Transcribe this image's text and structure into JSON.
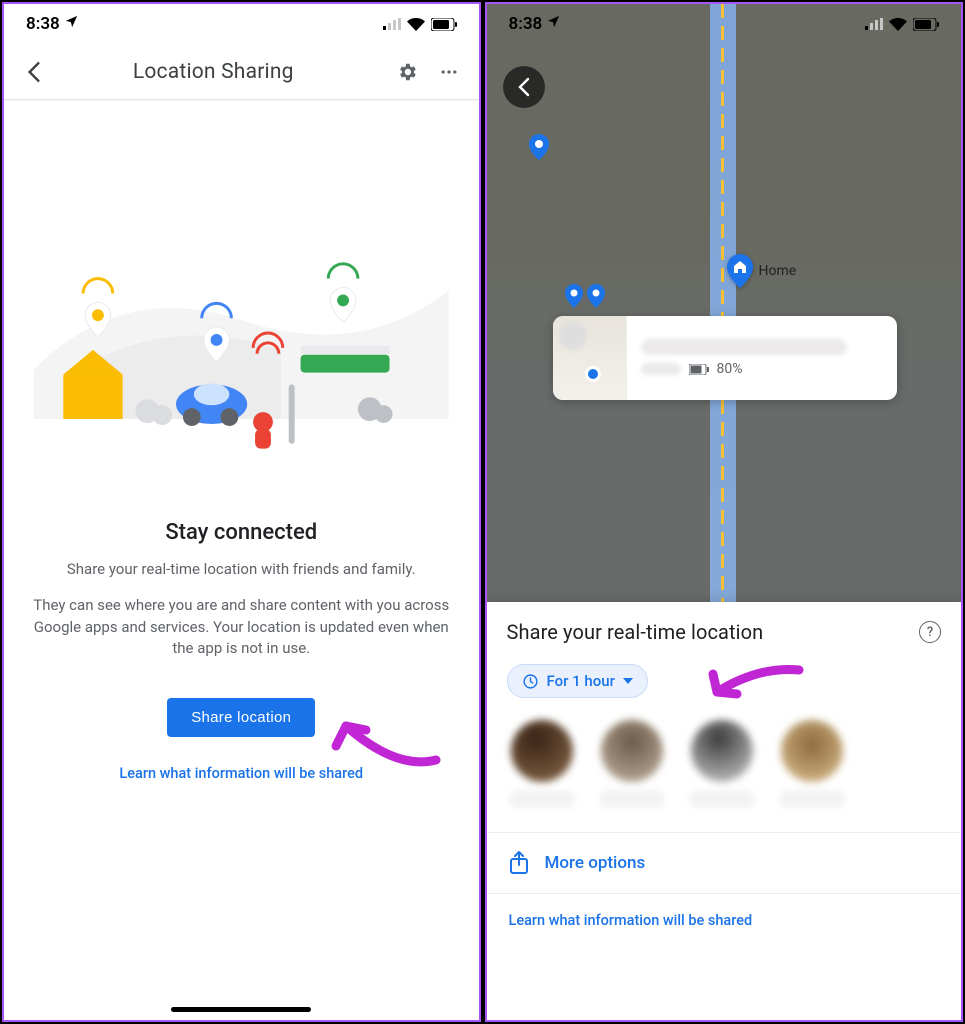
{
  "status": {
    "time": "8:38"
  },
  "left": {
    "header_title": "Location Sharing",
    "stay_title": "Stay connected",
    "stay_p1": "Share your real-time location with friends and family.",
    "stay_p2": "They can see where you are and share content with you across Google apps and services. Your location is updated even when the app is not in use.",
    "share_button": "Share location",
    "learn_link": "Learn what information will be shared"
  },
  "right": {
    "home_label": "Home",
    "battery_pct": "80%",
    "sheet_title": "Share your real-time location",
    "duration_label": "For 1 hour",
    "more_options": "More options",
    "learn_link": "Learn what information will be shared"
  }
}
